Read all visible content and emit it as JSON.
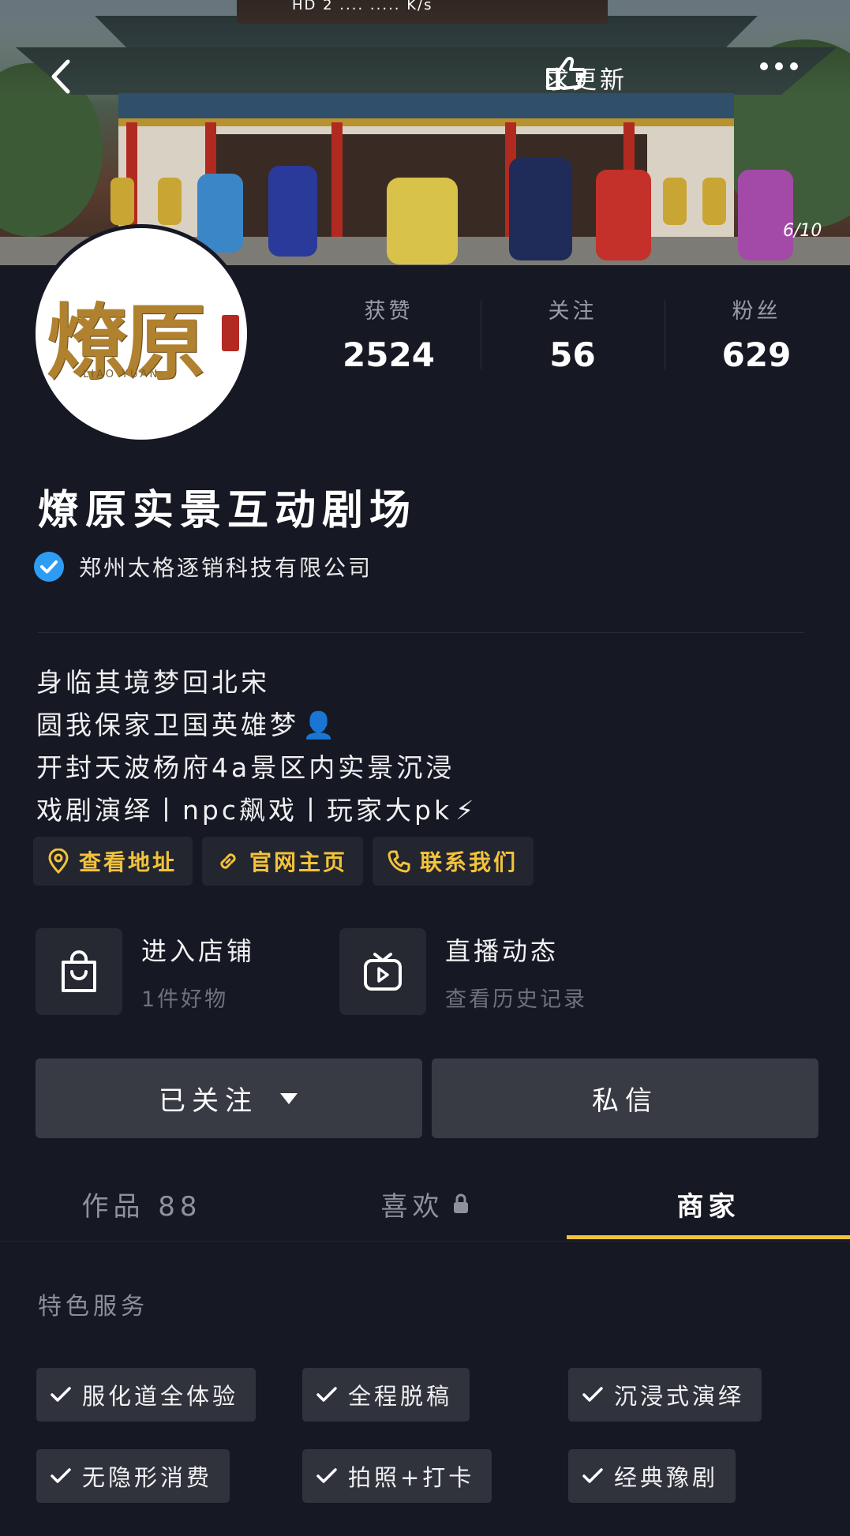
{
  "status_bar": {
    "text": "HD 2 .... ..... K/s"
  },
  "header": {
    "update_label": "求更新",
    "page_indicator": "6/10",
    "icons": {
      "back": "back-arrow-icon",
      "update": "hand-point-icon",
      "more": "more-dots-icon"
    }
  },
  "avatar": {
    "logo_text": "燎原",
    "logo_sub": "LIAO YUAN"
  },
  "stats": [
    {
      "label": "获赞",
      "value": "2524"
    },
    {
      "label": "关注",
      "value": "56"
    },
    {
      "label": "粉丝",
      "value": "629"
    }
  ],
  "profile": {
    "name": "燎原实景互动剧场",
    "verified_label": "郑州太格逐销科技有限公司"
  },
  "bio": {
    "line1": "身临其境梦回北宋",
    "line2": "圆我保家卫国英雄梦",
    "line2_emoji": "👤",
    "line3": "开封天波杨府4a景区内实景沉浸",
    "line4": "戏剧演绎丨npc飙戏丨玩家大pk",
    "line4_emoji": "⚡"
  },
  "links": [
    {
      "label": "查看地址",
      "icon": "location-pin-icon"
    },
    {
      "label": "官网主页",
      "icon": "link-icon"
    },
    {
      "label": "联系我们",
      "icon": "phone-icon"
    }
  ],
  "services": [
    {
      "title": "进入店铺",
      "sub": "1件好物",
      "icon": "shopping-bag-icon"
    },
    {
      "title": "直播动态",
      "sub": "查看历史记录",
      "icon": "live-tv-icon"
    }
  ],
  "actions": {
    "follow_label": "已关注",
    "message_label": "私信"
  },
  "tabs": [
    {
      "label": "作品 88",
      "active": false
    },
    {
      "label": "喜欢",
      "active": false,
      "icon": "lock-icon"
    },
    {
      "label": "商家",
      "active": true
    }
  ],
  "features": {
    "title": "特色服务",
    "items": [
      "服化道全体验",
      "全程脱稿",
      "沉浸式演绎",
      "无隐形消费",
      "拍照+打卡",
      "经典豫剧"
    ]
  },
  "colors": {
    "accent": "#f2c33b",
    "background": "#161823",
    "verified": "#2f9cf4"
  }
}
